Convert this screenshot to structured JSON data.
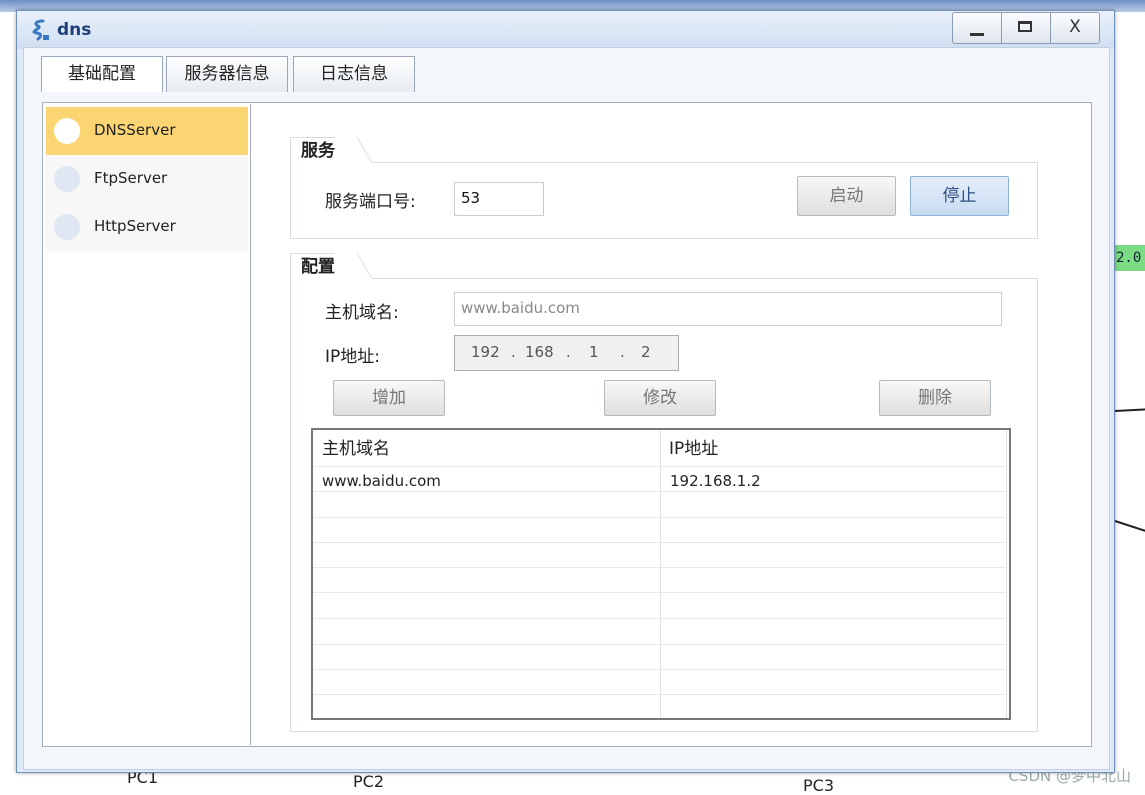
{
  "window": {
    "title": "dns",
    "controls": {
      "minimize_icon": "minimize-icon",
      "maximize_icon": "maximize-icon",
      "close_label": "X"
    }
  },
  "tabs": [
    {
      "label": "基础配置",
      "active": true
    },
    {
      "label": "服务器信息",
      "active": false
    },
    {
      "label": "日志信息",
      "active": false
    }
  ],
  "servers": [
    {
      "label": "DNSServer",
      "selected": true
    },
    {
      "label": "FtpServer",
      "selected": false
    },
    {
      "label": "HttpServer",
      "selected": false
    }
  ],
  "service": {
    "group_title": "服务",
    "port_label": "服务端口号:",
    "port_value": "53",
    "start_label": "启动",
    "stop_label": "停止"
  },
  "config": {
    "group_title": "配置",
    "domain_label": "主机域名:",
    "domain_placeholder": "www.baidu.com",
    "ip_label": "IP地址:",
    "ip_octets": [
      "192",
      "168",
      "1",
      "2"
    ],
    "ip_separator": ".",
    "add_label": "增加",
    "modify_label": "修改",
    "delete_label": "删除"
  },
  "table": {
    "columns": [
      "主机域名",
      "IP地址"
    ],
    "rows": [
      [
        "www.baidu.com",
        "192.168.1.2"
      ]
    ]
  },
  "background": {
    "labels": [
      "PC1",
      "PC2",
      "PC3"
    ],
    "ip_badge": "2.0",
    "watermark": "CSDN @梦中北山"
  },
  "colors": {
    "selected_server": "#fad571",
    "title_text": "#1f3f77",
    "ip_badge": "#7bdc84"
  }
}
